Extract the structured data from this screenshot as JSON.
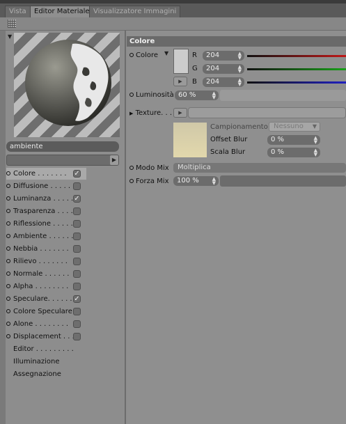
{
  "tabs": [
    {
      "label": "Vista",
      "active": false
    },
    {
      "label": "Editor Materiale",
      "active": true
    },
    {
      "label": "Visualizzatore Immagini",
      "active": false
    }
  ],
  "material": {
    "name": "ambiente"
  },
  "channels": [
    {
      "label": "Colore",
      "dots": " . . . . . . .",
      "checked": true,
      "selected": true
    },
    {
      "label": "Diffusione",
      "dots": " . . . . . .",
      "checked": false
    },
    {
      "label": "Luminanza",
      "dots": " . . . . .",
      "checked": true
    },
    {
      "label": "Trasparenza",
      "dots": " . . . .",
      "checked": false
    },
    {
      "label": "Riflessione",
      "dots": " . . . . .",
      "checked": false
    },
    {
      "label": "Ambiente",
      "dots": " . . . . . .",
      "checked": false
    },
    {
      "label": "Nebbia",
      "dots": " . . . . . . .",
      "checked": false
    },
    {
      "label": "Rilievo",
      "dots": " . . . . . . .",
      "checked": false
    },
    {
      "label": "Normale",
      "dots": " . . . . . .",
      "checked": false
    },
    {
      "label": "Alpha",
      "dots": " . . . . . . . .",
      "checked": false
    },
    {
      "label": "Speculare",
      "dots": ". . . . . .",
      "checked": true
    },
    {
      "label": "Colore Speculare",
      "dots": "",
      "checked": false
    },
    {
      "label": "Alone",
      "dots": " . . . . . . . .",
      "checked": false
    },
    {
      "label": "Displacement",
      "dots": " . . .",
      "checked": false
    }
  ],
  "extra_items": [
    {
      "label": "Editor . . . . . . . . ."
    },
    {
      "label": "Illuminazione"
    },
    {
      "label": "Assegnazione"
    }
  ],
  "panel": {
    "section_title": "Colore",
    "colore_label": "Colore",
    "rgb": [
      {
        "label": "R",
        "value": "204",
        "color": "#c01818"
      },
      {
        "label": "G",
        "value": "204",
        "color": "#18a018"
      },
      {
        "label": "B",
        "value": "204",
        "color": "#2020c0"
      }
    ],
    "swatch_color": "#cccccc",
    "luminosita_label": "Luminosità",
    "luminosita_value": "60 %",
    "luminosita_level": 0.6,
    "texture_label": "Texture. . .",
    "campionamento_label": "Campionamento",
    "campionamento_value": "Nessuno",
    "offset_blur_label": "Offset Blur",
    "offset_blur_value": "0 %",
    "scala_blur_label": "Scala Blur",
    "scala_blur_value": "0 %",
    "modo_mix_label": "Modo Mix",
    "modo_mix_value": "Moltiplica",
    "forza_mix_label": "Forza Mix",
    "forza_mix_value": "100 %",
    "forza_mix_level": 1.0
  },
  "colors": {
    "panel_bg": "#8f8f8f",
    "field_bg": "#6c6c6c",
    "section_bg": "#6a6a6a"
  }
}
